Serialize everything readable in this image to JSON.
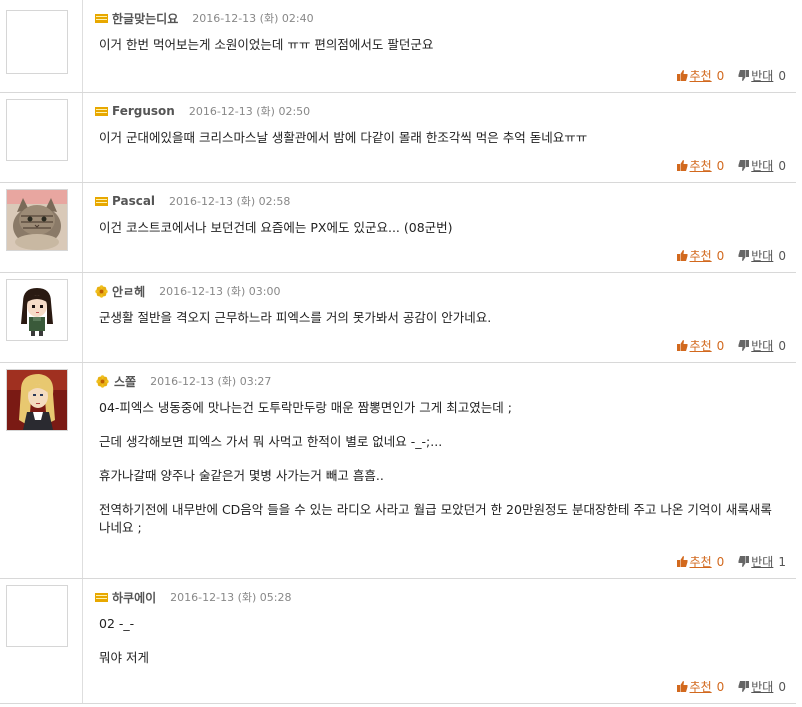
{
  "comments": [
    {
      "nickname": "한글맞는디요",
      "date": "2016-12-13 (화) 02:40",
      "lines": [
        "이거 한번 먹어보는게 소원이었는데 ㅠㅠ 편의점에서도 팔던군요"
      ],
      "up_label": "추천",
      "up_count": "0",
      "down_label": "반대",
      "down_count": "0"
    },
    {
      "nickname": "Ferguson",
      "date": "2016-12-13 (화) 02:50",
      "lines": [
        "이거 군대에있을때 크리스마스날 생활관에서 밤에 다같이 몰래 한조각씩 먹은 추억 돋네요ㅠㅠ"
      ],
      "up_label": "추천",
      "up_count": "0",
      "down_label": "반대",
      "down_count": "0"
    },
    {
      "nickname": "Pascal",
      "date": "2016-12-13 (화) 02:58",
      "lines": [
        "이건 코스트코에서나 보던건데 요즘에는 PX에도 있군요... (08군번)"
      ],
      "up_label": "추천",
      "up_count": "0",
      "down_label": "반대",
      "down_count": "0"
    },
    {
      "nickname": "안ㄹ헤",
      "date": "2016-12-13 (화) 03:00",
      "lines": [
        "군생활 절반을 격오지 근무하느라 피엑스를 거의 못가봐서 공감이 안가네요."
      ],
      "up_label": "추천",
      "up_count": "0",
      "down_label": "반대",
      "down_count": "0"
    },
    {
      "nickname": "스쫄",
      "date": "2016-12-13 (화) 03:27",
      "lines": [
        "04-피엑스 냉동중에 맛나는건 도투락만두랑 매운 짬뽕면인가 그게 최고였는데 ;",
        "근데 생각해보면 피엑스 가서 뭐 사먹고 한적이 별로 없네요 -_-;...",
        "휴가나갈때 양주나 술같은거 몇병 사가는거 빼고 흠흠..",
        "전역하기전에 내무반에 CD음악 들을 수 있는 라디오 사라고 월급 모았던거 한 20만원정도 분대장한테 주고 나온 기억이 새록새록 나네요 ;"
      ],
      "up_label": "추천",
      "up_count": "0",
      "down_label": "반대",
      "down_count": "1"
    },
    {
      "nickname": "하쿠에이",
      "date": "2016-12-13 (화) 05:28",
      "lines": [
        "02 -_-",
        "뭐야 저게"
      ],
      "up_label": "추천",
      "up_count": "0",
      "down_label": "반대",
      "down_count": "0"
    }
  ],
  "colors": {
    "upvote": "#d2691e",
    "level_bar": "#e8a800",
    "flower": "#f0c020"
  }
}
